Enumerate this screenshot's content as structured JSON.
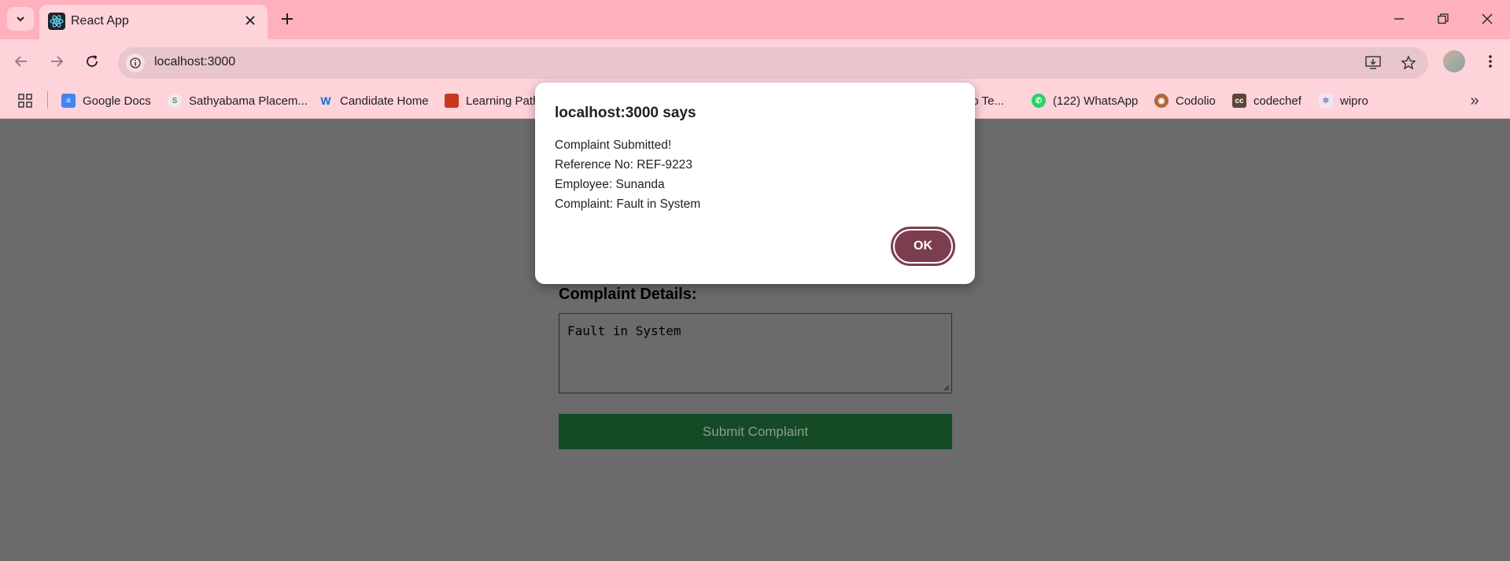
{
  "browser": {
    "tab_title": "React App",
    "url": "localhost:3000",
    "bookmarks": [
      {
        "label": "Google Docs",
        "icon": "google-docs-icon",
        "color": "#4285f4"
      },
      {
        "label": "Sathyabama Placem...",
        "icon": "sathyabama-icon",
        "color": "#d8d8d8"
      },
      {
        "label": "Candidate Home",
        "icon": "workday-icon",
        "color": "#f5a623"
      },
      {
        "label": "Learning Path",
        "icon": "learning-path-icon",
        "color": "#c8381e"
      },
      {
        "label": "io Te...",
        "icon": "",
        "color": ""
      },
      {
        "label": "(122) WhatsApp",
        "icon": "whatsapp-icon",
        "color": "#25d366"
      },
      {
        "label": "Codolio",
        "icon": "codolio-icon",
        "color": "#b0683a"
      },
      {
        "label": "codechef",
        "icon": "codechef-icon",
        "color": "#5b4638"
      },
      {
        "label": "wipro",
        "icon": "wipro-icon",
        "color": "#e9e0f0"
      }
    ]
  },
  "page": {
    "complaint_label": "Complaint Details:",
    "complaint_text": "Fault in System",
    "submit_label": "Submit Complaint"
  },
  "dialog": {
    "title": "localhost:3000 says",
    "lines": [
      "Complaint Submitted!",
      "Reference No: REF-9223",
      "Employee: Sunanda",
      "Complaint: Fault in System"
    ],
    "ok_label": "OK"
  }
}
